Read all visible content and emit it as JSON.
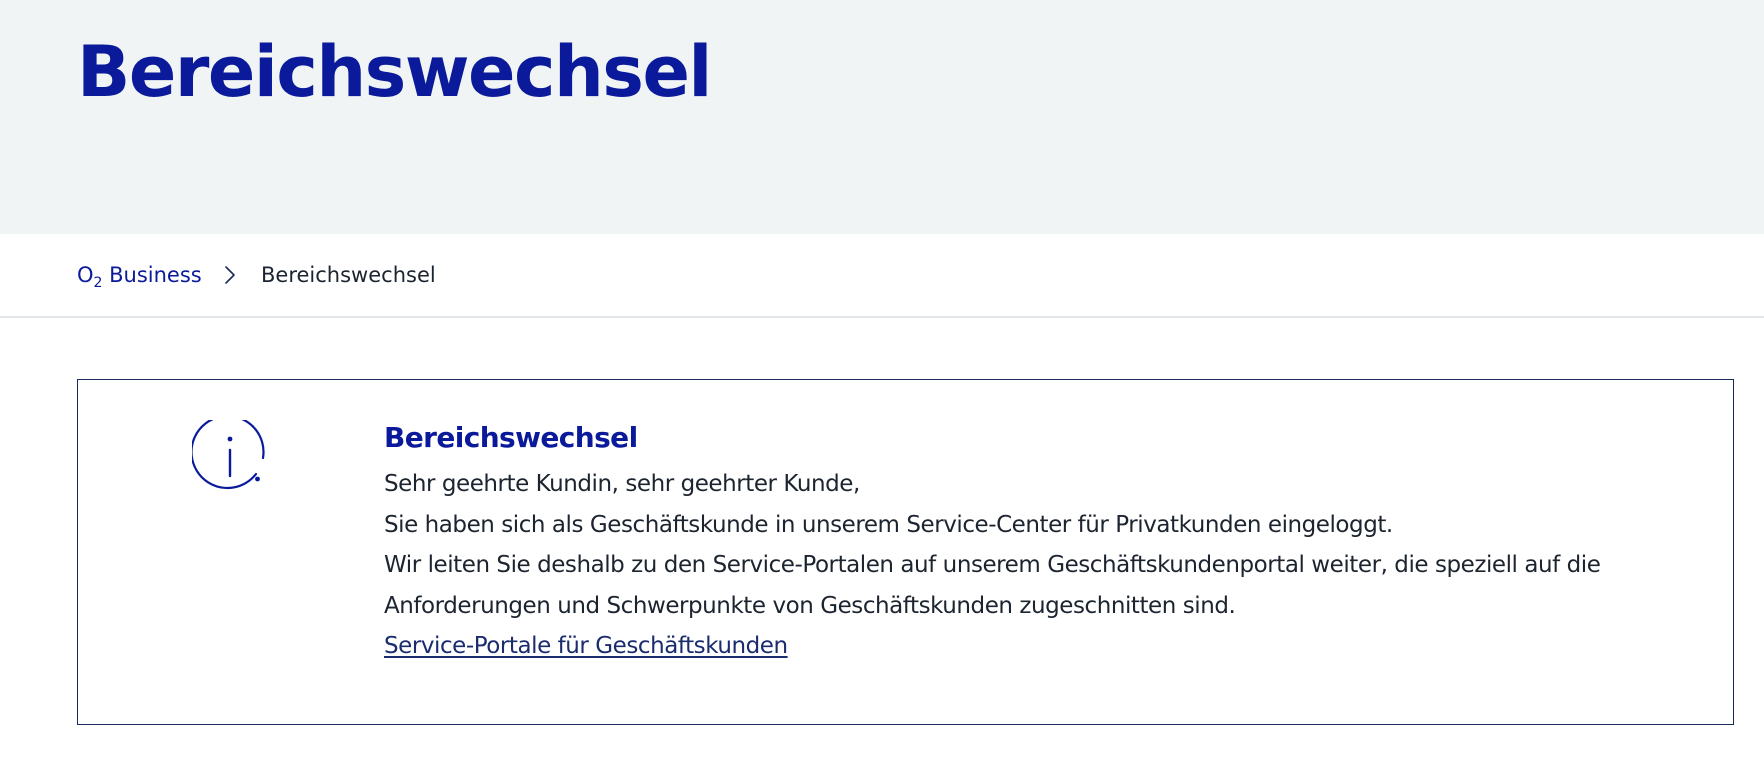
{
  "header": {
    "title": "Bereichswechsel"
  },
  "breadcrumb": {
    "home_label": "O",
    "home_subscript": "2",
    "home_suffix": " Business",
    "current": "Bereichswechsel",
    "separator_icon": "chevron-right-icon"
  },
  "notice": {
    "icon": "info-icon",
    "title": "Bereichswechsel",
    "greeting": "Sehr geehrte Kundin, sehr geehrter Kunde,",
    "line1": "Sie haben sich als Geschäftskunde in unserem Service-Center für Privatkunden eingeloggt.",
    "line2": "Wir leiten Sie deshalb zu den Service-Portalen auf unserem Geschäftskundenportal weiter, die speziell auf die",
    "line3": "Anforderungen und Schwerpunkte von Geschäftskunden zugeschnitten sind.",
    "link_label": "Service-Portale für Geschäftskunden"
  },
  "colors": {
    "brand": "#0a1a9a",
    "hero_background": "#f0f4f5",
    "text": "#1c2430",
    "border": "#1a2c5c"
  }
}
